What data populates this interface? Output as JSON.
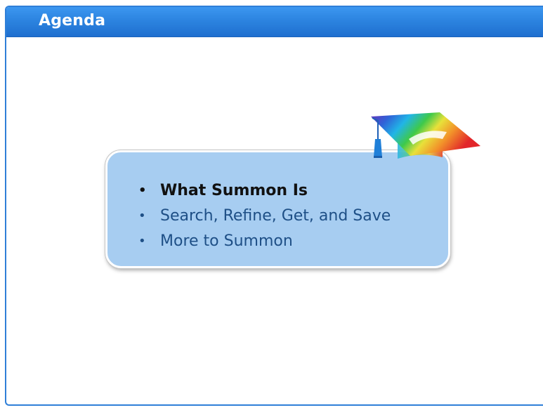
{
  "header": {
    "title": "Agenda"
  },
  "agenda": {
    "items": [
      {
        "label": "What Summon Is",
        "active": true
      },
      {
        "label": "Search, Refine, Get, and Save",
        "active": false
      },
      {
        "label": "More to Summon",
        "active": false
      }
    ],
    "bullet": "•"
  },
  "decoration": {
    "icon": "graduation-cap-icon"
  },
  "colors": {
    "title_bar": "#2c84e0",
    "callout_fill": "#a7cdf1",
    "active_text": "#111111",
    "inactive_text": "#1e4f86"
  }
}
